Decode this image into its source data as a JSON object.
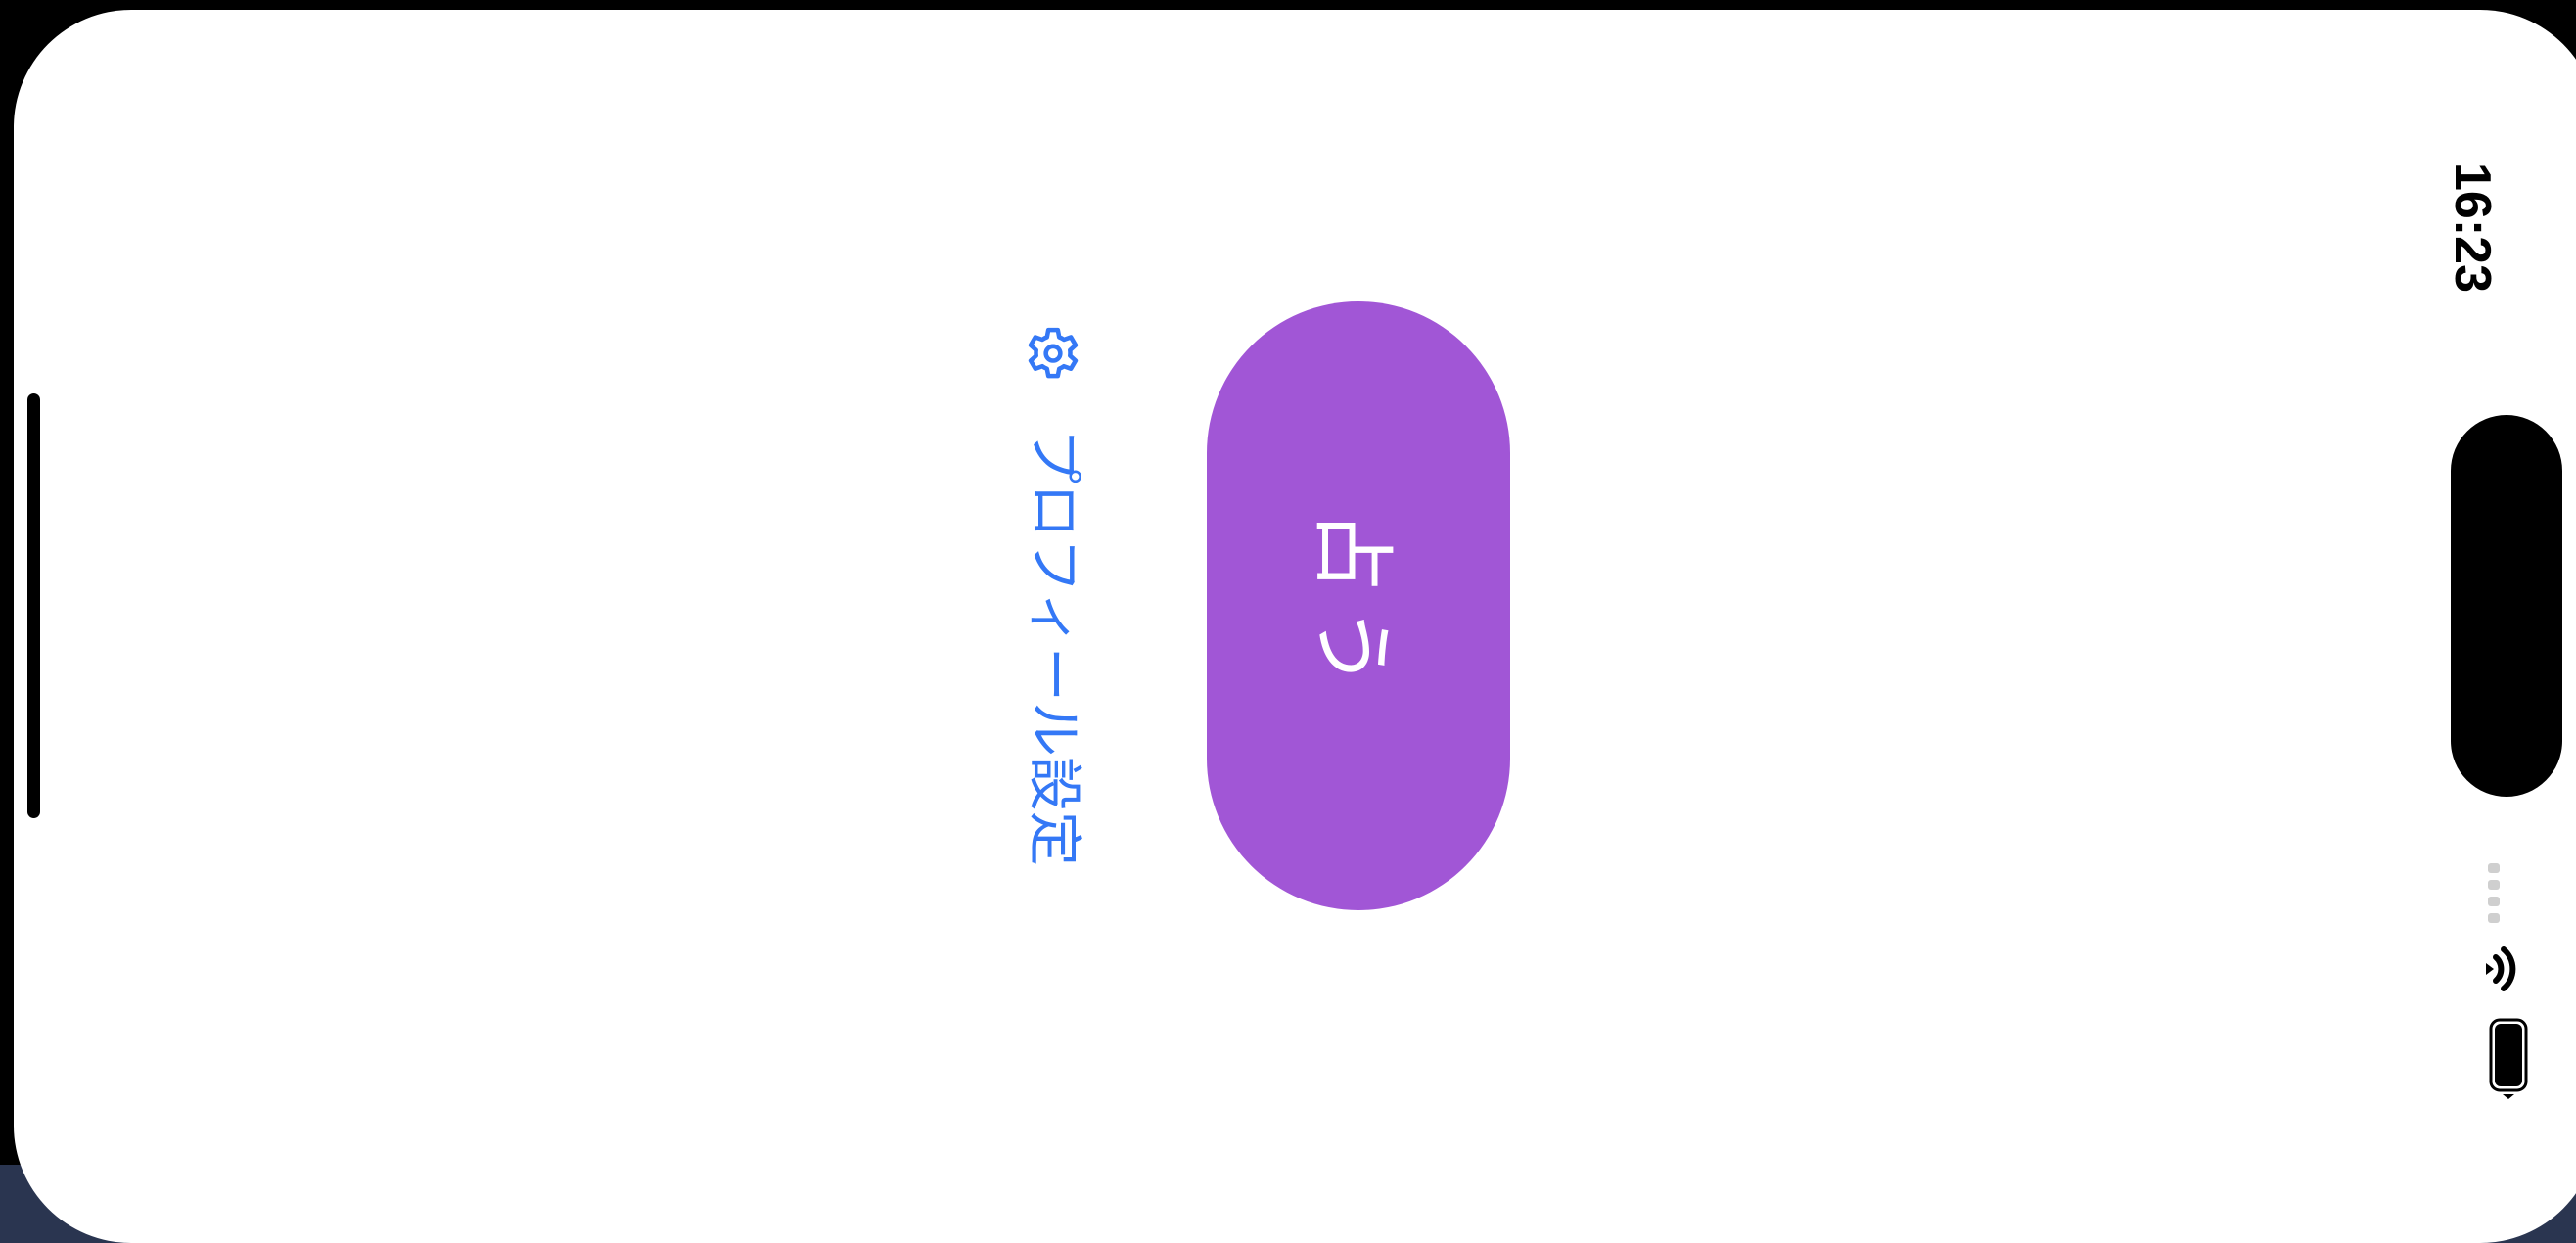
{
  "status_bar": {
    "time": "16:23"
  },
  "main_button": {
    "label": "占う",
    "color": "#a156d6"
  },
  "settings_link": {
    "label": "プロフィール設定",
    "icon": "gear-icon",
    "color": "#3478f6"
  }
}
